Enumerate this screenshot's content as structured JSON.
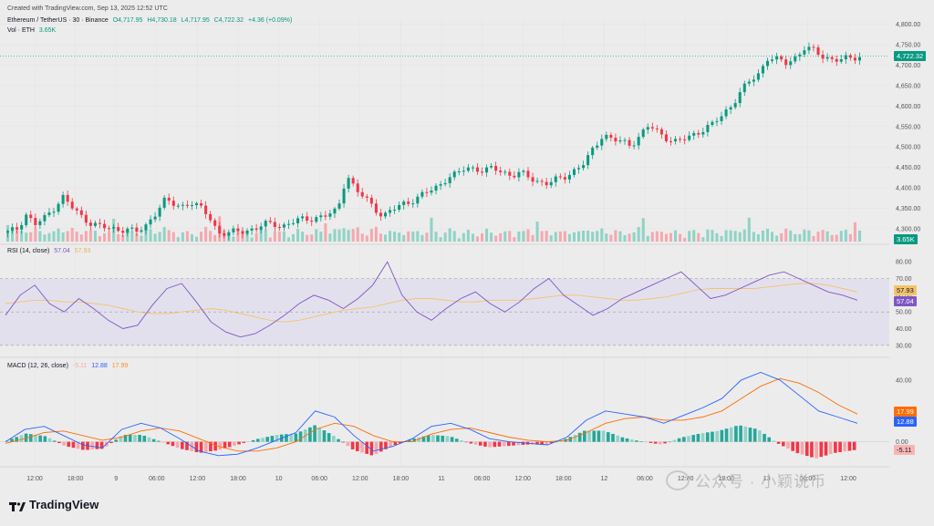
{
  "header": {
    "created": "Created with TradingView.com, Sep 13, 2025 12:52 UTC",
    "symbol": "Ethereum / TetherUS · 30 · Binance",
    "open": "O4,717.95",
    "high": "H4,730.18",
    "low": "L4,717.95",
    "close": "C4,722.32",
    "change": "+4.36 (+0.09%)",
    "vol_label": "Vol · ETH",
    "vol_value": "3.65K"
  },
  "rsi_legend": {
    "label": "RSI (14, close)",
    "rsi": "57.04",
    "ma": "57.93"
  },
  "macd_legend": {
    "label": "MACD (12, 26, close)",
    "hist": "-5.11",
    "macd": "12.88",
    "signal": "17.99"
  },
  "badges": {
    "price": "4,722.32",
    "vol": "3.65K",
    "rsi_ma": "57.93",
    "rsi": "57.04",
    "macd_signal": "17.99",
    "macd": "12.88",
    "macd_hist": "-5.11"
  },
  "brand": "TradingView",
  "watermark": "公众号 · 小颖说币",
  "colors": {
    "up": "#089981",
    "down": "#f23645",
    "rsi": "#7e57c2",
    "rsi_ma": "#f5c36b",
    "macd": "#2962ff",
    "signal": "#ff6d00"
  },
  "chart_data": [
    {
      "type": "candlestick",
      "price_axis_ticks": [
        "4,800.00",
        "4,750.00",
        "4,700.00",
        "4,650.00",
        "4,600.00",
        "4,550.00",
        "4,500.00",
        "4,450.00",
        "4,400.00",
        "4,350.00",
        "4,300.00"
      ],
      "ylim": [
        4275,
        4815
      ],
      "time_axis_ticks": [
        "12:00",
        "18:00",
        "9",
        "06:00",
        "12:00",
        "18:00",
        "10",
        "06:00",
        "12:00",
        "18:00",
        "11",
        "06:00",
        "12:00",
        "18:00",
        "12",
        "06:00",
        "12:00",
        "18:00",
        "13",
        "06:00",
        "12:00"
      ],
      "close_path": [
        4290,
        4300,
        4335,
        4310,
        4325,
        4350,
        4378,
        4352,
        4330,
        4315,
        4306,
        4300,
        4298,
        4300,
        4290,
        4305,
        4335,
        4368,
        4360,
        4355,
        4365,
        4350,
        4330,
        4290,
        4288,
        4292,
        4296,
        4300,
        4310,
        4312,
        4306,
        4315,
        4322,
        4325,
        4328,
        4333,
        4345,
        4435,
        4392,
        4375,
        4352,
        4330,
        4345,
        4360,
        4368,
        4378,
        4392,
        4405,
        4425,
        4432,
        4450,
        4448,
        4440,
        4448,
        4440,
        4430,
        4435,
        4425,
        4415,
        4410,
        4420,
        4430,
        4445,
        4460,
        4498,
        4532,
        4518,
        4512,
        4505,
        4528,
        4552,
        4535,
        4522,
        4512,
        4520,
        4532,
        4545,
        4555,
        4578,
        4602,
        4635,
        4660,
        4680,
        4720,
        4712,
        4705,
        4720,
        4742,
        4735,
        4722,
        4715,
        4712,
        4718,
        4722
      ]
    },
    {
      "type": "line",
      "title": "RSI (14, close)",
      "ylim": [
        25,
        85
      ],
      "y_ticks": [
        "80.00",
        "70.00",
        "60.00",
        "50.00",
        "40.00",
        "30.00"
      ],
      "band": [
        30,
        70
      ],
      "series": [
        {
          "name": "RSI",
          "values": [
            48,
            60,
            66,
            55,
            50,
            58,
            52,
            45,
            40,
            42,
            54,
            64,
            67,
            56,
            44,
            38,
            35,
            37,
            42,
            48,
            55,
            60,
            57,
            52,
            58,
            66,
            80,
            60,
            50,
            45,
            52,
            58,
            62,
            55,
            50,
            56,
            64,
            70,
            60,
            54,
            48,
            52,
            58,
            62,
            66,
            70,
            74,
            66,
            58,
            60,
            64,
            68,
            72,
            74,
            70,
            66,
            62,
            60,
            57
          ]
        },
        {
          "name": "RSI MA",
          "values": [
            55,
            56,
            57,
            57,
            56,
            56,
            55,
            54,
            52,
            50,
            49,
            49,
            50,
            51,
            52,
            51,
            49,
            47,
            45,
            44,
            45,
            47,
            49,
            51,
            52,
            53,
            55,
            57,
            58,
            58,
            57,
            56,
            56,
            57,
            57,
            57,
            58,
            59,
            60,
            60,
            59,
            58,
            57,
            57,
            58,
            59,
            61,
            63,
            64,
            64,
            64,
            64,
            65,
            66,
            67,
            67,
            66,
            64,
            62
          ]
        }
      ]
    },
    {
      "type": "line",
      "title": "MACD (12, 26, close)",
      "ylim": [
        -15,
        50
      ],
      "y_ticks": [
        "40.00",
        "20.00",
        "0.00"
      ],
      "series": [
        {
          "name": "MACD",
          "values": [
            0,
            8,
            10,
            4,
            -2,
            -4,
            8,
            12,
            9,
            2,
            -6,
            -9,
            -8,
            -4,
            1,
            6,
            20,
            16,
            4,
            -6,
            -3,
            2,
            10,
            12,
            8,
            2,
            0,
            -1,
            -2,
            3,
            14,
            20,
            18,
            16,
            12,
            17,
            22,
            28,
            40,
            45,
            40,
            30,
            20,
            16,
            12
          ]
        },
        {
          "name": "Signal",
          "values": [
            -1,
            2,
            6,
            7,
            4,
            1,
            3,
            7,
            9,
            7,
            2,
            -3,
            -6,
            -6,
            -4,
            0,
            8,
            12,
            10,
            4,
            0,
            0,
            5,
            8,
            9,
            6,
            3,
            1,
            0,
            1,
            6,
            12,
            15,
            16,
            14,
            14,
            16,
            20,
            28,
            36,
            41,
            38,
            32,
            24,
            18
          ]
        }
      ]
    }
  ]
}
